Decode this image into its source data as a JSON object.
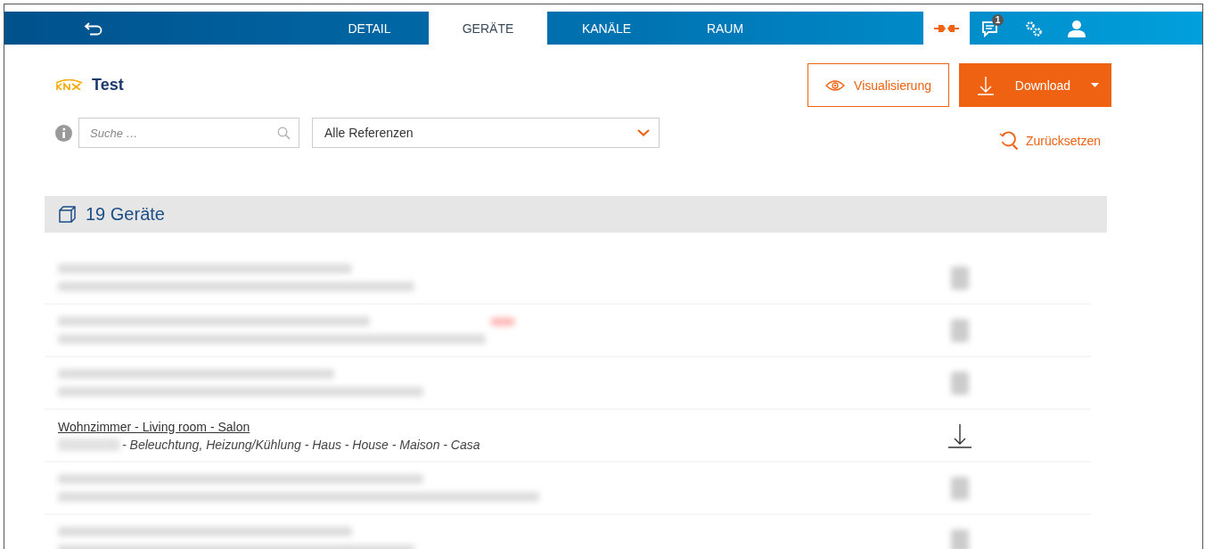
{
  "topbar": {
    "tabs": [
      {
        "label": "DETAIL",
        "selected": false
      },
      {
        "label": "GERÄTE",
        "selected": true
      },
      {
        "label": "KANÄLE",
        "selected": false
      },
      {
        "label": "RAUM",
        "selected": false
      }
    ],
    "notifications": "1"
  },
  "project": {
    "title": "Test"
  },
  "buttons": [
    {
      "label": "Visualisierung",
      "kind": "outline"
    },
    {
      "label": "Download",
      "kind": "primary"
    }
  ],
  "search": {
    "placeholder": "Suche …"
  },
  "filter": {
    "value": "Alle Referenzen"
  },
  "reset": {
    "label": "Zurücksetzen"
  },
  "devices": {
    "title": "19 Geräte",
    "rows": [
      {
        "kind": "redacted",
        "tag": false
      },
      {
        "kind": "redacted",
        "tag": true
      },
      {
        "kind": "redacted",
        "tag": false
      },
      {
        "kind": "device",
        "title": "Wohnzimmer - Living room - Salon",
        "subtitle": "- Beleuchtung, Heizung/Kühlung - Haus - House - Maison - Casa"
      },
      {
        "kind": "redacted",
        "tag": false
      },
      {
        "kind": "redacted",
        "tag": false
      }
    ]
  }
}
